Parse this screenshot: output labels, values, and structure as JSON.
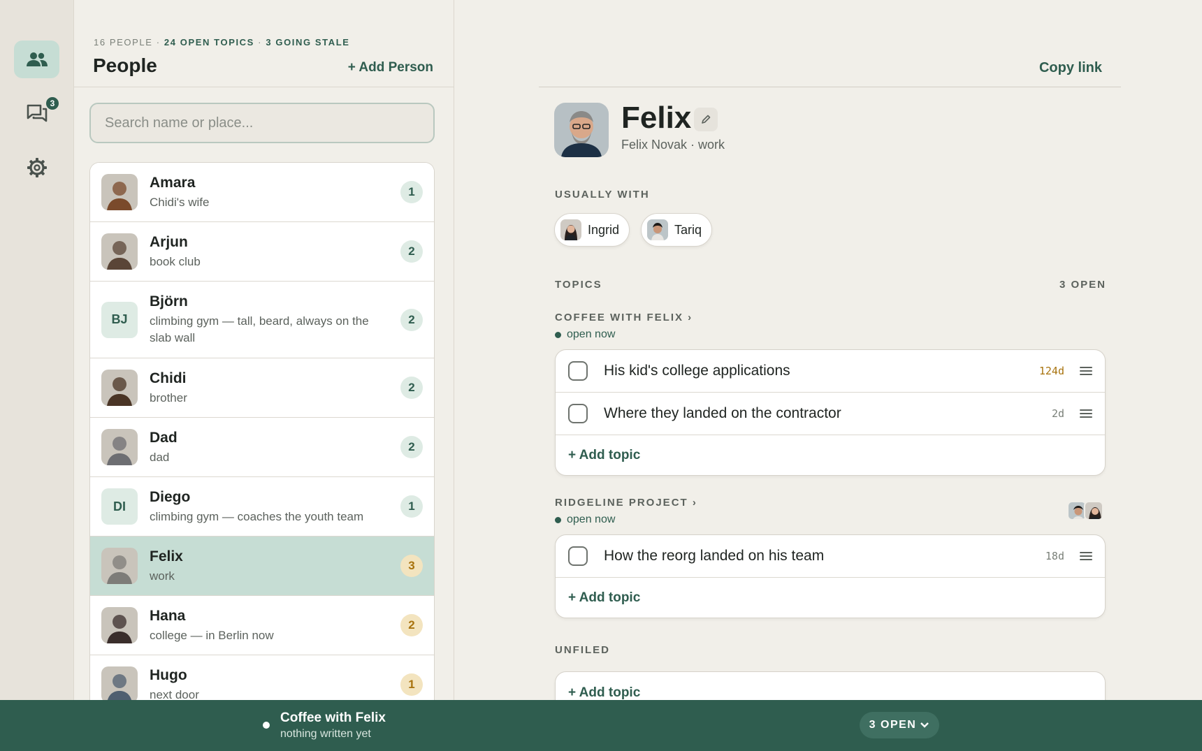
{
  "rail": {
    "items": [
      {
        "icon": "people-icon",
        "active": true
      },
      {
        "icon": "chat-icon",
        "badge": "3"
      },
      {
        "icon": "gear-icon"
      }
    ]
  },
  "people_panel": {
    "stats_people": "16 PEOPLE",
    "stats_sep1": " · ",
    "stats_topics": "24 OPEN TOPICS",
    "stats_sep2": " · ",
    "stats_stale": "3 GOING STALE",
    "title": "People",
    "add_label": "+ Add Person",
    "search_placeholder": "Search name or place..."
  },
  "people": [
    {
      "name": "Amara",
      "desc": "Chidi's wife",
      "count": "1",
      "initials": "",
      "color": "#7a4a2b"
    },
    {
      "name": "Arjun",
      "desc": "book club",
      "count": "2",
      "initials": "",
      "color": "#5a4537"
    },
    {
      "name": "Björn",
      "desc": "climbing gym — tall, beard, always on the slab wall",
      "count": "2",
      "initials": "BJ"
    },
    {
      "name": "Chidi",
      "desc": "brother",
      "count": "2",
      "initials": "",
      "color": "#4a3526"
    },
    {
      "name": "Dad",
      "desc": "dad",
      "count": "2",
      "initials": "",
      "color": "#6d6e72"
    },
    {
      "name": "Diego",
      "desc": "climbing gym — coaches the youth team",
      "count": "1",
      "initials": "DI"
    },
    {
      "name": "Felix",
      "desc": "work",
      "count": "3",
      "initials": "",
      "color": "#7d7c78",
      "selected": true,
      "amber": true
    },
    {
      "name": "Hana",
      "desc": "college — in Berlin now",
      "count": "2",
      "initials": "",
      "color": "#3a2e2c",
      "amber": true
    },
    {
      "name": "Hugo",
      "desc": "next door",
      "count": "1",
      "initials": "",
      "color": "#4f5f70",
      "amber": true
    }
  ],
  "detail": {
    "copy_link": "Copy link",
    "name": "Felix",
    "subtitle": "Felix Novak · work",
    "usually_with_label": "USUALLY WITH",
    "usually_with": [
      "Ingrid",
      "Tariq"
    ],
    "topics_label": "TOPICS",
    "topics_open": "3 OPEN",
    "groups": [
      {
        "title": "COFFEE WITH FELIX ›",
        "status": "open now",
        "topics": [
          {
            "text": "His kid's college applications",
            "age": "124d",
            "stale": true
          },
          {
            "text": "Where they landed on the contractor",
            "age": "2d",
            "stale": false
          }
        ],
        "add_label": "+ Add topic"
      },
      {
        "title": "RIDGELINE PROJECT ›",
        "status": "open now",
        "topics": [
          {
            "text": "How the reorg landed on his team",
            "age": "18d",
            "stale": false
          }
        ],
        "add_label": "+ Add topic"
      }
    ],
    "unfiled_label": "UNFILED",
    "unfiled_add": "+ Add topic"
  },
  "bottom_bar": {
    "title": "Coffee with Felix",
    "subtitle": "nothing written yet",
    "pill": "3 OPEN"
  },
  "colors": {
    "accent": "#2f5d4f",
    "selected_row": "#c6ddd4",
    "stale": "#a8730e"
  }
}
